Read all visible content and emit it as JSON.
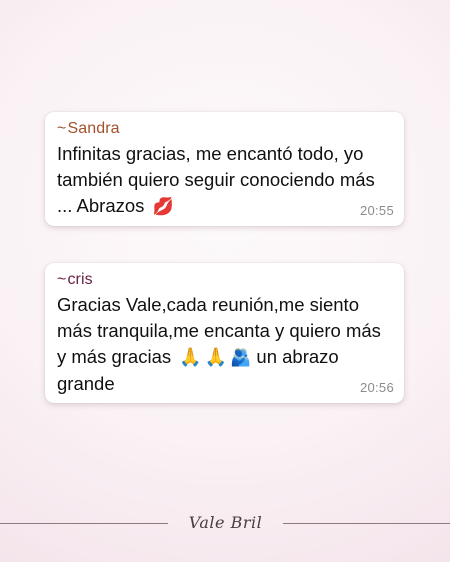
{
  "messages": [
    {
      "tilde": "~",
      "sender": "Sandra",
      "sender_color": "#a0522d",
      "text": "Infinitas gracias, me encantó todo, yo también quiero seguir conociendo más ... Abrazos",
      "emoji": "💋",
      "time": "20:55"
    },
    {
      "tilde": "~",
      "sender": "cris",
      "sender_color": "#6b2144",
      "text": "Gracias Vale,cada reunión,me siento más tranquila,me encanta y quiero más y más gracias",
      "emoji_pray_1": "🙏",
      "emoji_pray_2": "🙏",
      "emoji_hug": "🫂",
      "text_end": "un abrazo grande",
      "time": "20:56"
    }
  ],
  "footer": {
    "signature": "Vale Bril"
  }
}
